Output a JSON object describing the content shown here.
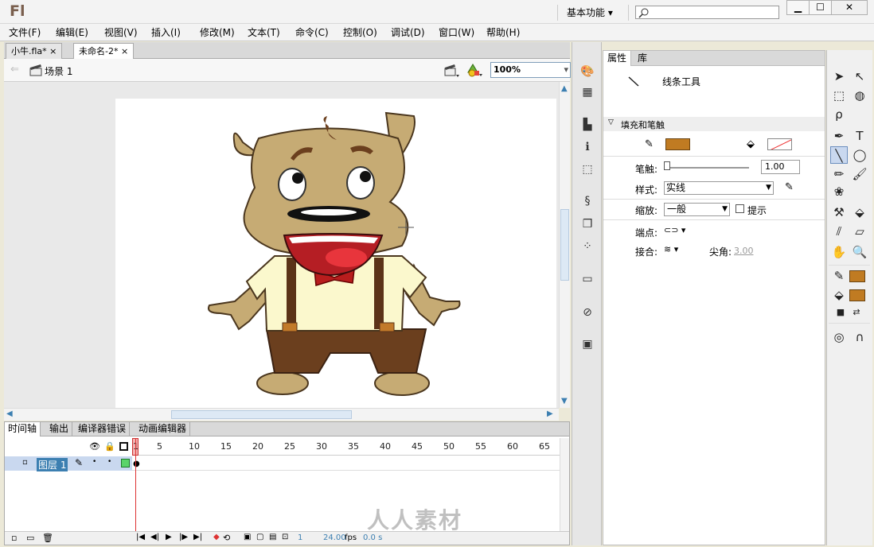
{
  "app": {
    "logo": "Fl",
    "workspace": "基本功能",
    "workspace_arrow": "▾"
  },
  "window_buttons": [
    "▁",
    "☐",
    "✕"
  ],
  "menu": [
    "文件(F)",
    "编辑(E)",
    "视图(V)",
    "插入(I)",
    "修改(M)",
    "文本(T)",
    "命令(C)",
    "控制(O)",
    "调试(D)",
    "窗口(W)",
    "帮助(H)"
  ],
  "doc_tabs": [
    {
      "label": "小牛.fla*",
      "close": "×"
    },
    {
      "label": "未命名-2*",
      "close": "×"
    }
  ],
  "editbar": {
    "scene": "场景 1",
    "zoom": "100%",
    "zoom_arrow": "▾"
  },
  "timeline": {
    "tabs": [
      "时间轴",
      "输出",
      "编译器错误",
      "动画编辑器"
    ],
    "frame_numbers": [
      "1",
      "5",
      "10",
      "15",
      "20",
      "25",
      "30",
      "35",
      "40",
      "45",
      "50",
      "55",
      "60",
      "65"
    ],
    "layer_name": "图层 1",
    "current_frame": "1",
    "fps": "24.00",
    "fps_unit": "fps",
    "elapsed": "0.0 s"
  },
  "properties": {
    "tabs": [
      "属性",
      "库"
    ],
    "tool_name": "线条工具",
    "section": "填充和笔触",
    "stroke_label": "笔触:",
    "stroke_value": "1.00",
    "style_label": "样式:",
    "style_value": "实线",
    "scale_label": "缩放:",
    "scale_value": "一般",
    "hint_label": "提示",
    "cap_label": "端点:",
    "join_label": "接合:",
    "miter_label": "尖角:",
    "miter_value": "3.00"
  },
  "colors": {
    "stroke": "#c07b22",
    "fill": "#c07b22",
    "accent": "#3c7fb1"
  },
  "watermark": "人人素材"
}
